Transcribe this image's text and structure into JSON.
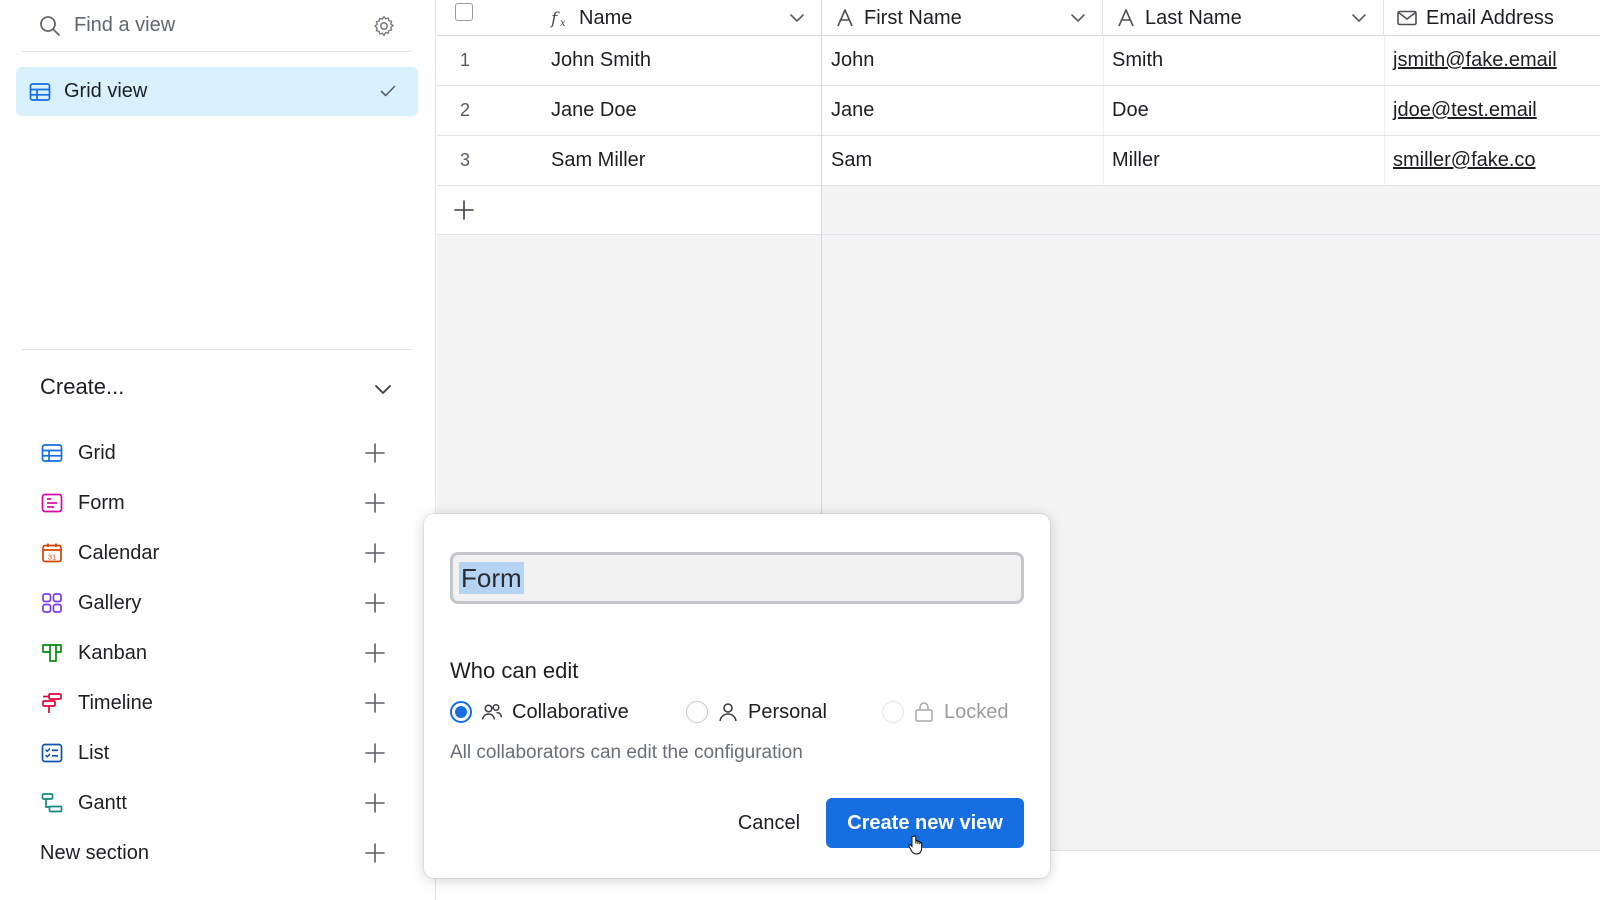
{
  "sidebar": {
    "search_placeholder": "Find a view",
    "active_view": "Grid view",
    "create_header": "Create...",
    "create_items": [
      {
        "label": "Grid",
        "icon": "grid-icon",
        "color": "#166ee1"
      },
      {
        "label": "Form",
        "icon": "form-icon",
        "color": "#dd04a8"
      },
      {
        "label": "Calendar",
        "icon": "calendar-icon",
        "color": "#d54401"
      },
      {
        "label": "Gallery",
        "icon": "gallery-icon",
        "color": "#7c39ed"
      },
      {
        "label": "Kanban",
        "icon": "kanban-icon",
        "color": "#048a0e"
      },
      {
        "label": "Timeline",
        "icon": "timeline-icon",
        "color": "#dc043b"
      },
      {
        "label": "List",
        "icon": "list-icon",
        "color": "#0d52ac"
      },
      {
        "label": "Gantt",
        "icon": "gantt-icon",
        "color": "#138a82"
      }
    ],
    "new_section": "New section"
  },
  "grid": {
    "columns": [
      {
        "label": "Name",
        "icon": "formula-icon"
      },
      {
        "label": "First Name",
        "icon": "text-field-icon"
      },
      {
        "label": "Last Name",
        "icon": "text-field-icon"
      },
      {
        "label": "Email Address",
        "icon": "email-icon"
      }
    ],
    "rows": [
      {
        "num": "1",
        "name": "John Smith",
        "first": "John",
        "last": "Smith",
        "email": "jsmith@fake.email"
      },
      {
        "num": "2",
        "name": "Jane Doe",
        "first": "Jane",
        "last": "Doe",
        "email": "jdoe@test.email"
      },
      {
        "num": "3",
        "name": "Sam Miller",
        "first": "Sam",
        "last": "Miller",
        "email": "smiller@fake.co"
      }
    ]
  },
  "modal": {
    "view_name": "Form",
    "who_label": "Who can edit",
    "options": [
      {
        "label": "Collaborative",
        "selected": true,
        "icon": "collaborators-icon"
      },
      {
        "label": "Personal",
        "selected": false,
        "icon": "person-icon"
      },
      {
        "label": "Locked",
        "selected": false,
        "icon": "lock-icon",
        "disabled": true
      }
    ],
    "hint": "All collaborators can edit the configuration",
    "cancel_label": "Cancel",
    "create_label": "Create new view"
  },
  "colors": {
    "accent": "#166ee1",
    "active_bg": "#d9f1fd"
  }
}
